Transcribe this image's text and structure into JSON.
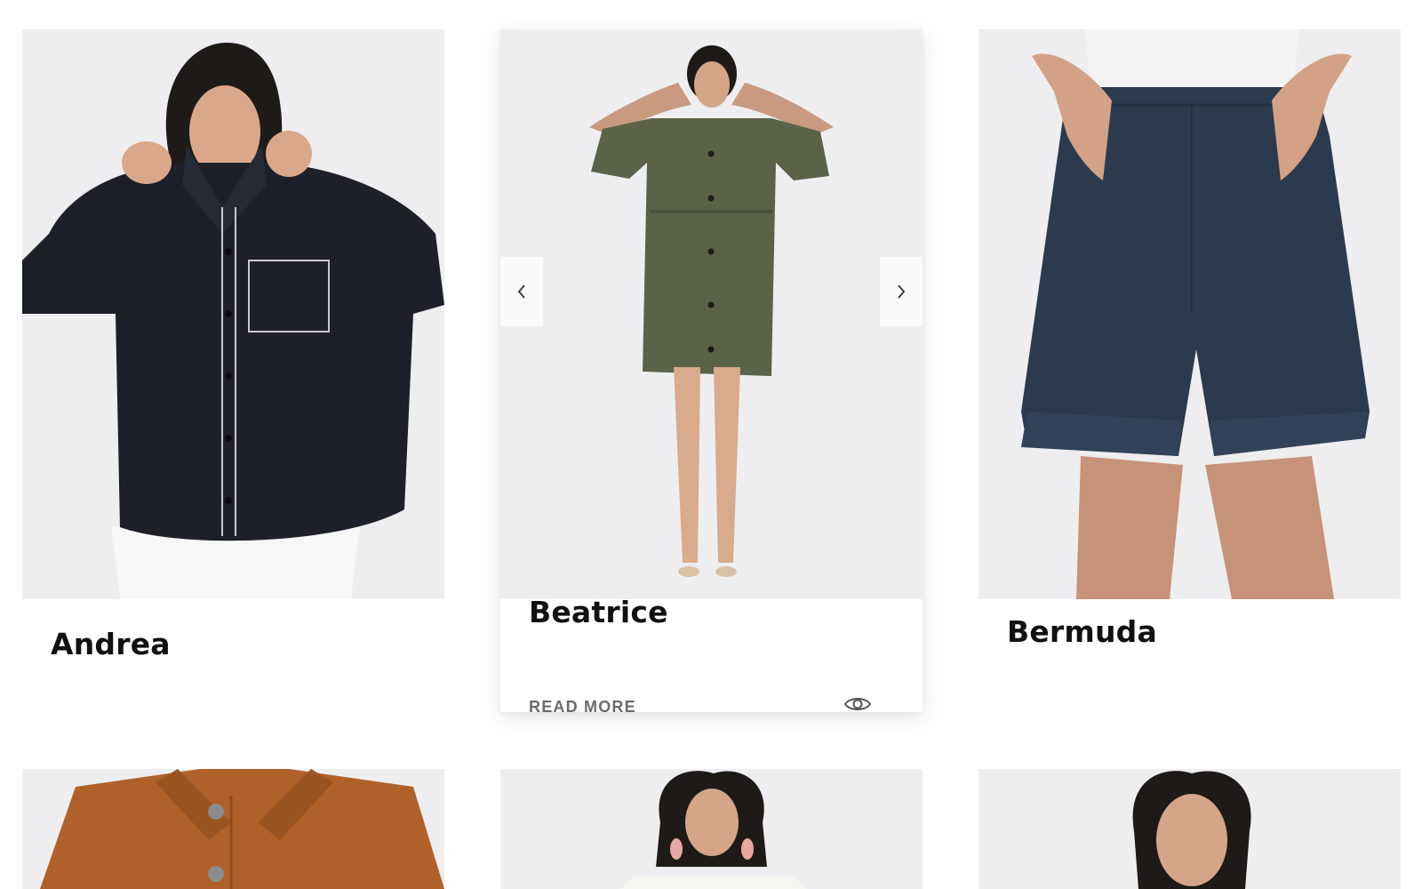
{
  "products": [
    {
      "name": "Andrea"
    },
    {
      "name": "Beatrice",
      "read_more": "READ MORE"
    },
    {
      "name": "Bermuda"
    }
  ],
  "carousel": {
    "prev_icon": "chevron-left-icon",
    "next_icon": "chevron-right-icon"
  },
  "colors": {
    "photo_bg": "#ececee",
    "jacket": "#1b1d24",
    "dress": "#5a6348",
    "shorts": "#2c3a4e",
    "suede": "#b0612a",
    "text": "#111111",
    "muted": "#6b6b6b"
  }
}
